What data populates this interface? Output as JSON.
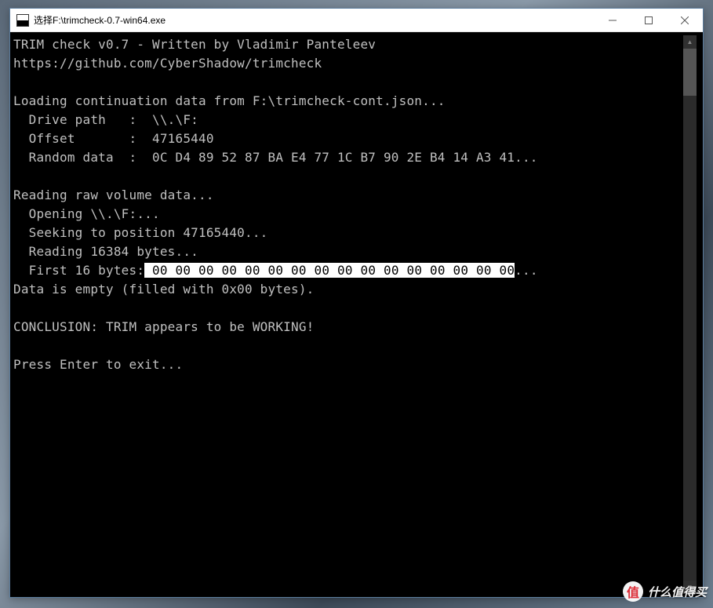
{
  "window": {
    "title": "选择F:\\trimcheck-0.7-win64.exe"
  },
  "console": {
    "line01": "TRIM check v0.7 - Written by Vladimir Panteleev",
    "line02": "https://github.com/CyberShadow/trimcheck",
    "line03": "",
    "line04": "Loading continuation data from F:\\trimcheck-cont.json...",
    "line05": "  Drive path   :  \\\\.\\F:",
    "line06": "  Offset       :  47165440",
    "line07": "  Random data  :  0C D4 89 52 87 BA E4 77 1C B7 90 2E B4 14 A3 41...",
    "line08": "",
    "line09": "Reading raw volume data...",
    "line10": "  Opening \\\\.\\F:...",
    "line11": "  Seeking to position 47165440...",
    "line12": "  Reading 16384 bytes...",
    "line13a": "  First 16 bytes:",
    "line13b": " 00 00 00 00 00 00 00 00 00 00 00 00 00 00 00 00",
    "line13c": "...",
    "line14": "Data is empty (filled with 0x00 bytes).",
    "line15": "",
    "line16": "CONCLUSION: TRIM appears to be WORKING!",
    "line17": "",
    "line18": "Press Enter to exit..."
  },
  "watermark": {
    "logo": "值",
    "text": "什么值得买"
  }
}
